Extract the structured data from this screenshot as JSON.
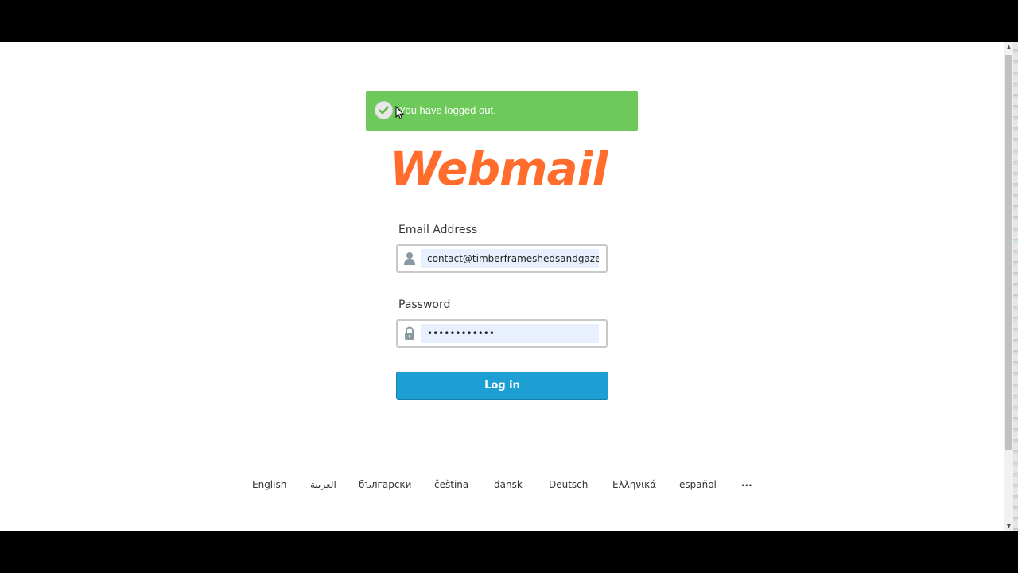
{
  "alert": {
    "message": "You have logged out.",
    "icon": "check-circle-icon",
    "color": "#6cc95a"
  },
  "logo": {
    "text": "Webmail",
    "color": "#ff6c2c"
  },
  "form": {
    "email_label": "Email Address",
    "email_value": "contact@timberframeshedsandgazeb",
    "email_icon": "user-icon",
    "password_label": "Password",
    "password_value": "••••••••••••",
    "password_icon": "lock-icon",
    "login_label": "Log in",
    "button_color": "#1e9fd4"
  },
  "languages": {
    "items": [
      "English",
      "العربية",
      "български",
      "čeština",
      "dansk",
      "Deutsch",
      "Ελληνικά",
      "español"
    ],
    "more": "..."
  }
}
